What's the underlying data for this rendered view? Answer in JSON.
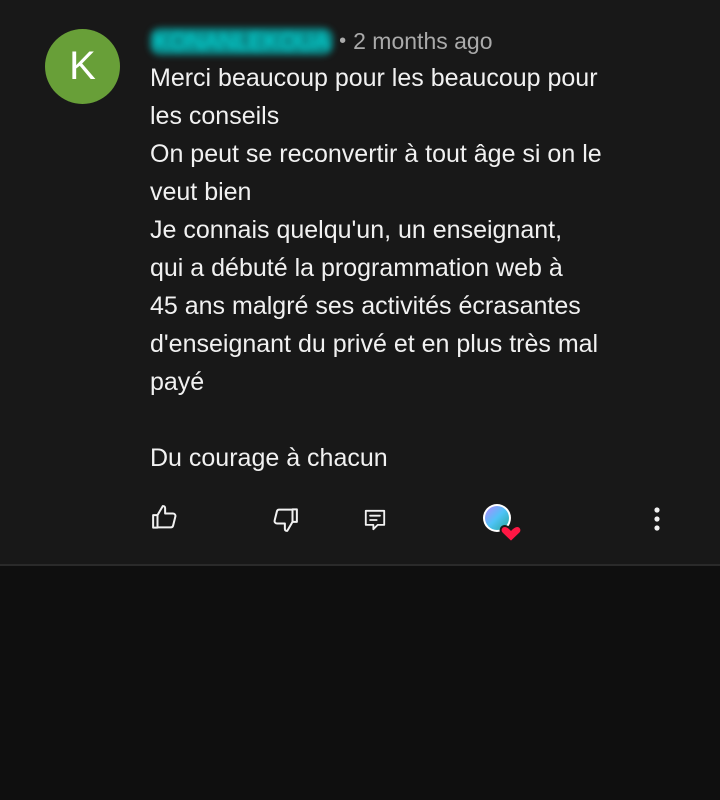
{
  "comment": {
    "avatar_letter": "K",
    "author": "KONANLEKOUA",
    "separator": "•",
    "time": "2 months ago",
    "text": "Merci beaucoup pour les beaucoup pour\nles conseils\nOn peut se reconvertir à tout âge si on le\nveut bien\nJe connais quelqu'un, un enseignant,\nqui a débuté la programmation web à\n45 ans malgré ses activités écrasantes\nd'enseignant du privé et en plus très mal\npayé\n\nDu courage à chacun"
  },
  "actions": {
    "like_icon": "thumbs-up-icon",
    "dislike_icon": "thumbs-down-icon",
    "reply_icon": "reply-icon",
    "heart_icon": "creator-heart-icon",
    "more_icon": "more-vertical-icon"
  },
  "colors": {
    "card_background": "#181818",
    "page_background": "#0f0f0f",
    "avatar": "#689f38",
    "text": "#f1f1f1",
    "secondary_text": "#aaaaaa",
    "heart": "#ff0033"
  }
}
